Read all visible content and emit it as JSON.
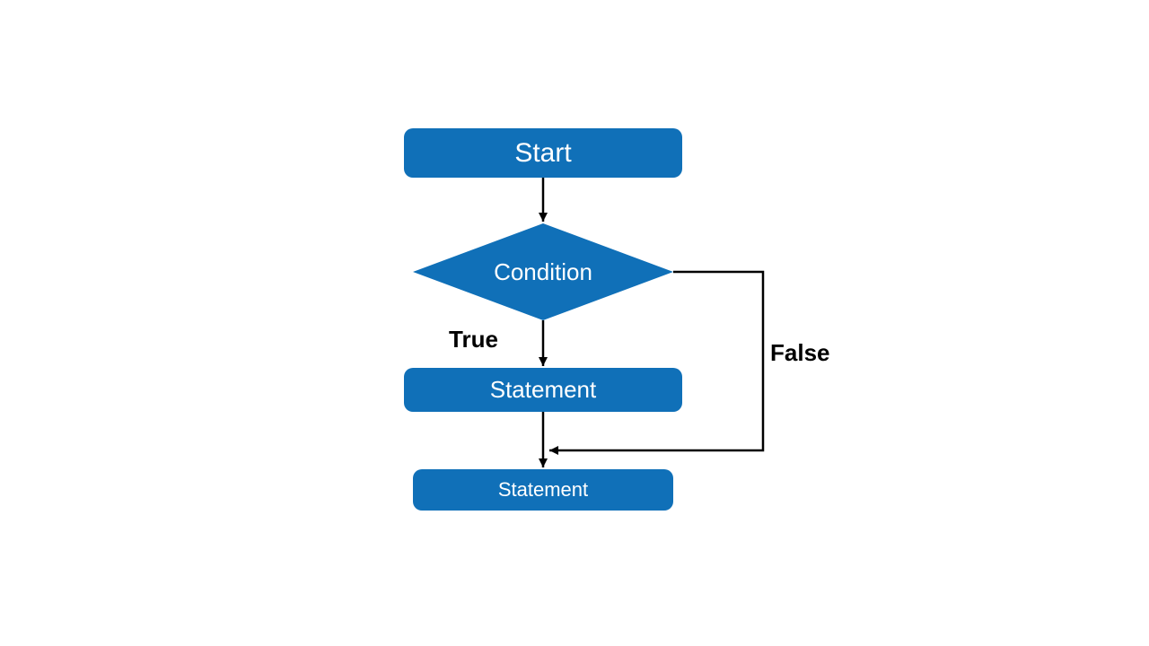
{
  "diagram": {
    "colors": {
      "node_fill": "#1070b8",
      "node_text": "#ffffff",
      "line": "#000000",
      "label": "#000000"
    },
    "nodes": {
      "start": {
        "label": "Start",
        "shape": "rounded-rect"
      },
      "condition": {
        "label": "Condition",
        "shape": "diamond"
      },
      "statement1": {
        "label": "Statement",
        "shape": "rounded-rect"
      },
      "statement2": {
        "label": "Statement",
        "shape": "rounded-rect"
      }
    },
    "edges": {
      "true_label": "True",
      "false_label": "False"
    },
    "flow": [
      {
        "from": "start",
        "to": "condition"
      },
      {
        "from": "condition",
        "to": "statement1",
        "label_key": "true_label"
      },
      {
        "from": "condition",
        "to": "statement2",
        "label_key": "false_label",
        "note": "bypass via right side"
      },
      {
        "from": "statement1",
        "to": "statement2"
      }
    ]
  }
}
